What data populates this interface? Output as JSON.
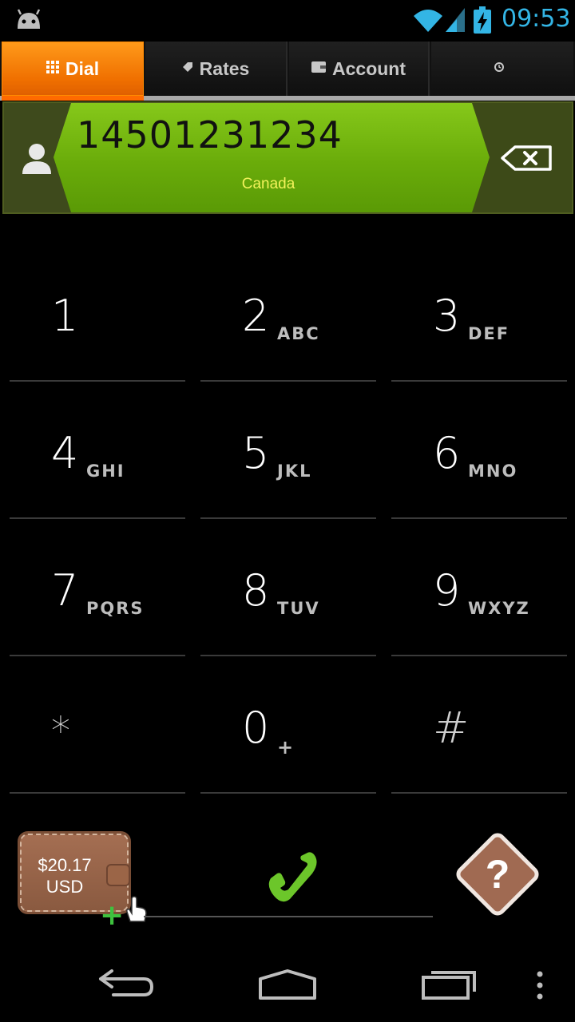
{
  "status_bar": {
    "time": "09:53",
    "icons": [
      "android-icon",
      "wifi-icon",
      "signal-icon",
      "battery-charging-icon"
    ]
  },
  "tabs": [
    {
      "label": "Dial",
      "icon": "grid-icon",
      "selected": true
    },
    {
      "label": "Rates",
      "icon": "tag-icon",
      "selected": false
    },
    {
      "label": "Account",
      "icon": "wallet-icon",
      "selected": false
    },
    {
      "label": "",
      "icon": "history-icon",
      "selected": false
    }
  ],
  "number_bar": {
    "number": "14501231234",
    "country": "Canada",
    "contact_icon": "contact-icon",
    "backspace_icon": "backspace-icon"
  },
  "keypad": [
    {
      "digit": "1",
      "letters": ""
    },
    {
      "digit": "2",
      "letters": "ABC"
    },
    {
      "digit": "3",
      "letters": "DEF"
    },
    {
      "digit": "4",
      "letters": "GHI"
    },
    {
      "digit": "5",
      "letters": "JKL"
    },
    {
      "digit": "6",
      "letters": "MNO"
    },
    {
      "digit": "7",
      "letters": "PQRS"
    },
    {
      "digit": "8",
      "letters": "TUV"
    },
    {
      "digit": "9",
      "letters": "WXYZ"
    },
    {
      "digit": "*",
      "letters": ""
    },
    {
      "digit": "0",
      "letters": "+"
    },
    {
      "digit": "#",
      "letters": ""
    }
  ],
  "bottom": {
    "balance_amount": "$20.17",
    "balance_currency": "USD",
    "call_icon": "phone-icon",
    "help_icon": "question-icon"
  },
  "colors": {
    "accent_orange": "#ff7a00",
    "number_field_green": "#7abf12",
    "country_yellow": "#f2f25a",
    "clock_blue": "#33b5e5",
    "call_green": "#6cc62a",
    "wallet_brown": "#9a6448",
    "help_brown": "#a06a52"
  }
}
